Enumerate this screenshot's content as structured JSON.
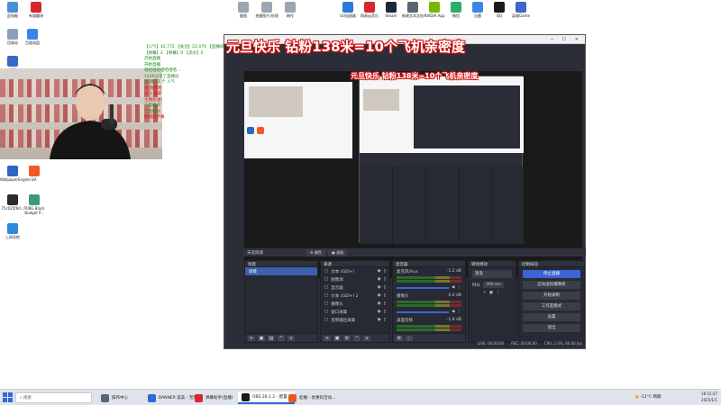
{
  "desktop": {
    "left_icons": [
      {
        "label": "此电脑",
        "color": "#4a8fd8"
      },
      {
        "label": "回收站",
        "color": "#8aa0b8"
      },
      {
        "label": "百度网盘",
        "color": "#3a86e8"
      },
      {
        "label": "WallpaperEngine:...",
        "color": "#2c66c4"
      },
      {
        "label": "EA",
        "color": "#f05a28"
      },
      {
        "label": "75c025f6d...",
        "color": "#2c2c2c"
      },
      {
        "label": "PUBG Black Budget P...",
        "color": "#3a9a78"
      },
      {
        "label": "上网导航",
        "color": "#2a8ad8"
      },
      {
        "label": "天网",
        "color": "#3a66c8"
      }
    ],
    "top_icons": [
      {
        "label": "有道翻译",
        "color": "#d8262e"
      },
      {
        "label": "截图",
        "color": "#9aa6b2"
      },
      {
        "label": "拍摄图片/处理",
        "color": "#9aa6b2"
      },
      {
        "label": "刷作",
        "color": "#9aa6b2"
      }
    ],
    "top_right_icons": [
      {
        "label": "UU加速器",
        "color": "#2a7ad8"
      },
      {
        "label": "网易云音乐",
        "color": "#d8262e"
      },
      {
        "label": "Steam",
        "color": "#1b2838"
      },
      {
        "label": "新建文本文档",
        "color": "#5a6474"
      },
      {
        "label": "NVIDIA App",
        "color": "#76b900"
      },
      {
        "label": "微信",
        "color": "#2aae67"
      },
      {
        "label": "迅雷",
        "color": "#3a86e8"
      },
      {
        "label": "QQ",
        "color": "#1a1a1a"
      },
      {
        "label": "英雄Game",
        "color": "#3a66c8"
      }
    ]
  },
  "chat": {
    "lines": [
      {
        "text": "【人气】42,772 【关注】22,070 【直播间】5",
        "red": false
      },
      {
        "text": "【弹幕】2 【弹幕】0 【流水】0",
        "red": false
      },
      {
        "text": "开始直播",
        "red": false
      },
      {
        "text": "开始直播",
        "red": false
      },
      {
        "text": "哈哈哈哈哈哈哈哈...",
        "red": false
      },
      {
        "text": "1426分享了直播间",
        "red": false
      },
      {
        "text": "送 跳了1 个 人气",
        "red": false
      },
      {
        "text": "送 哈哈哈",
        "red": true
      },
      {
        "text": "送 1 鼓掌",
        "red": true
      },
      {
        "text": "主播加油！",
        "red": true
      },
      {
        "text": "了直播间",
        "red": false
      },
      {
        "text": "了直播间",
        "red": false
      },
      {
        "text": "跟播的字幕",
        "red": true
      }
    ]
  },
  "obs": {
    "caption": "元旦快乐  钻粉138米=10个飞机亲密度",
    "nested_caption": "元旦快乐  钻粉138米=10个飞机亲密度",
    "toolbar_scene_label": "未选择源",
    "toolbar_btn1": "属性",
    "toolbar_btn2": "滤镜",
    "docks": {
      "scenes": {
        "title": "场景",
        "items": [
          "场景"
        ]
      },
      "sources": {
        "title": "来源",
        "items": [
          "文本 (GDI+)",
          "图像源",
          "显示器",
          "文本 (GDI+) 2",
          "摄像头",
          "窗口采集",
          "音频输出采集"
        ]
      },
      "mixer": {
        "title": "混音器",
        "channels": [
          {
            "name": "麦克风/Aux",
            "db": "-1.2 dB"
          },
          {
            "name": "摄像头",
            "db": "0.0 dB"
          },
          {
            "name": "桌面音频",
            "db": "-1.8 dB"
          }
        ]
      },
      "transitions": {
        "title": "转场特效",
        "type": "渐变",
        "duration_label": "时长",
        "duration": "300 ms"
      },
      "controls": {
        "title": "控制按钮",
        "buttons": [
          "停止直播",
          "启动虚拟摄像机",
          "开始录制",
          "工作室模式",
          "设置",
          "退出"
        ]
      }
    },
    "status": {
      "live": "LIVE: 00:00:00",
      "rec": "REC: 00:00:00",
      "cpu": "CPU: 2.0%, 60.00 fps"
    }
  },
  "taskbar": {
    "search_placeholder": "搜索",
    "items": [
      {
        "label": "操作中心",
        "active": false
      },
      {
        "label": "BANNER 美美 - 无限",
        "active": false
      },
      {
        "label": "弹幕助手(直播)",
        "active": false
      },
      {
        "label": "OBS 28.1.2 - 配置...",
        "active": true
      },
      {
        "label": "起播 - 优惠码活动...",
        "active": false
      }
    ],
    "weather": "-11°C 晴朗",
    "time": "16:15:37",
    "date": "2025/1/1"
  }
}
